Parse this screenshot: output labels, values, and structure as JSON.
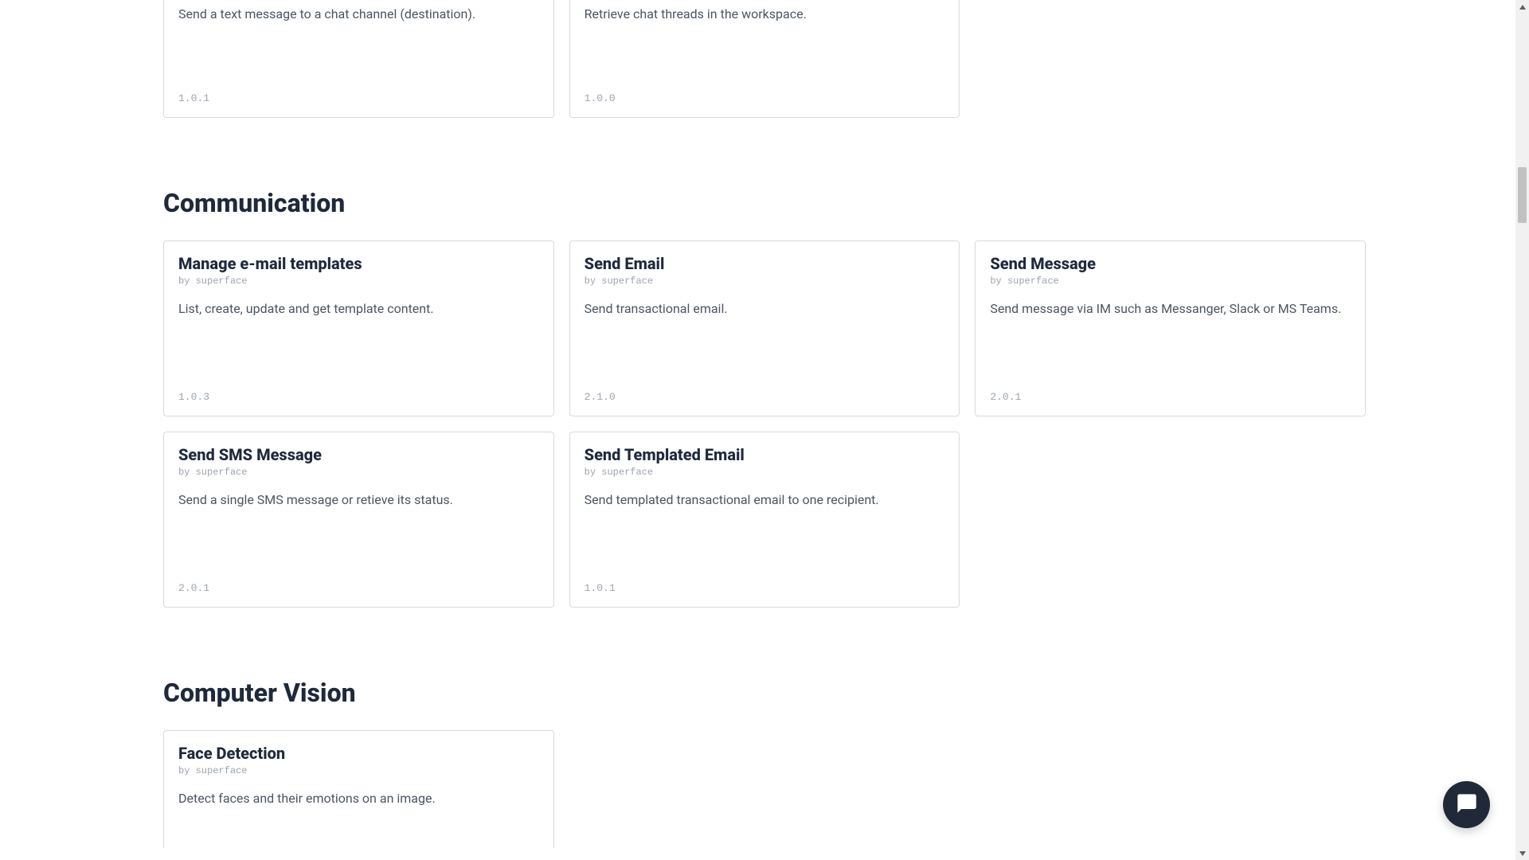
{
  "partial_section": {
    "cards": [
      {
        "description": "Send a text message to a chat channel (destination).",
        "version": "1.0.1"
      },
      {
        "description": "Retrieve chat threads in the workspace.",
        "version": "1.0.0"
      }
    ]
  },
  "sections": [
    {
      "title": "Communication",
      "cards": [
        {
          "title": "Manage e-mail templates",
          "author": "superface",
          "description": "List, create, update and get template content.",
          "version": "1.0.3"
        },
        {
          "title": "Send Email",
          "author": "superface",
          "description": "Send transactional email.",
          "version": "2.1.0"
        },
        {
          "title": "Send Message",
          "author": "superface",
          "description": "Send message via IM such as Messanger, Slack or MS Teams.",
          "version": "2.0.1"
        },
        {
          "title": "Send SMS Message",
          "author": "superface",
          "description": "Send a single SMS message or retieve its status.",
          "version": "2.0.1"
        },
        {
          "title": "Send Templated Email",
          "author": "superface",
          "description": "Send templated transactional email to one recipient.",
          "version": "1.0.1"
        }
      ]
    },
    {
      "title": "Computer Vision",
      "cards": [
        {
          "title": "Face Detection",
          "author": "superface",
          "description": "Detect faces and their emotions on an image.",
          "version": ""
        }
      ]
    }
  ],
  "by_label": "by"
}
